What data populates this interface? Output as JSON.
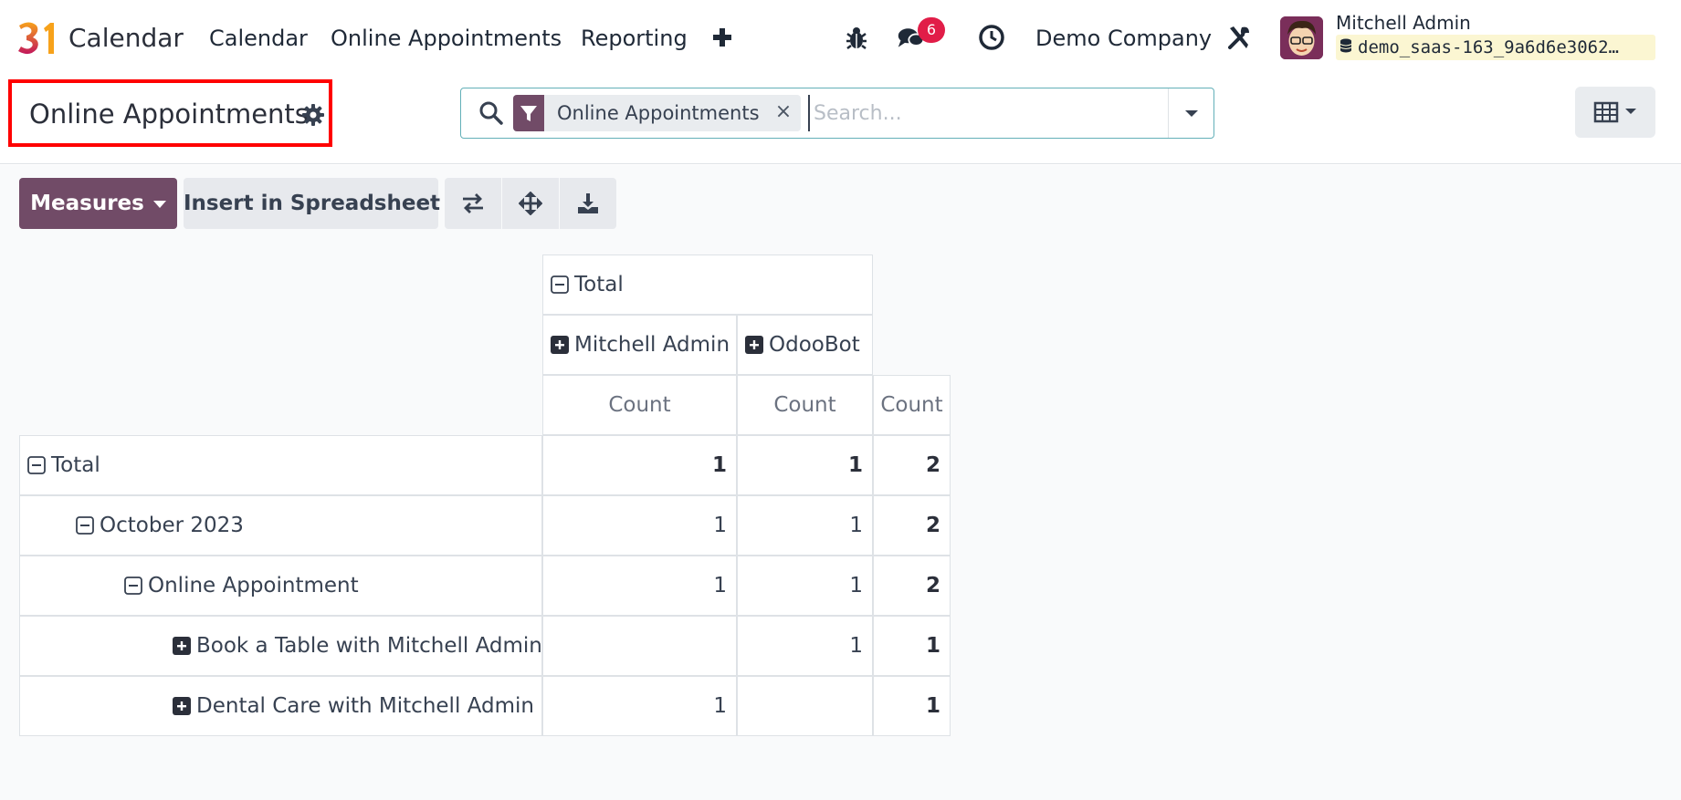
{
  "navbar": {
    "app_name": "Calendar",
    "menus": [
      "Calendar",
      "Online Appointments",
      "Reporting"
    ],
    "message_count": "6",
    "company": "Demo Company",
    "user_name": "Mitchell Admin",
    "database": "demo_saas-163_9a6d6e3062…"
  },
  "control_panel": {
    "title": "Online Appointments",
    "facet_label": "Online Appointments",
    "facet_close": "×",
    "search_placeholder": "Search..."
  },
  "toolbar": {
    "measures_label": "Measures",
    "insert_label": "Insert in Spreadsheet"
  },
  "pivot": {
    "col_header_total": "Total",
    "col_groups": [
      "Mitchell Admin",
      "OdooBot"
    ],
    "measure": "Count",
    "rows": [
      {
        "label": "Total",
        "toggle": "minus",
        "level": 0,
        "values": [
          "1",
          "1",
          "2"
        ]
      },
      {
        "label": "October 2023",
        "toggle": "minus",
        "level": 1,
        "values": [
          "1",
          "1",
          "2"
        ]
      },
      {
        "label": "Online Appointment",
        "toggle": "minus",
        "level": 2,
        "values": [
          "1",
          "1",
          "2"
        ]
      },
      {
        "label": "Book a Table with Mitchell Admin",
        "toggle": "plus",
        "level": 3,
        "values": [
          "",
          "1",
          "1"
        ]
      },
      {
        "label": "Dental Care with Mitchell Admin",
        "toggle": "plus",
        "level": 3,
        "values": [
          "1",
          "",
          "1"
        ]
      }
    ]
  },
  "colors": {
    "brand": "#714b67",
    "badge": "#e11d48",
    "highlight_border": "#ff0000"
  }
}
